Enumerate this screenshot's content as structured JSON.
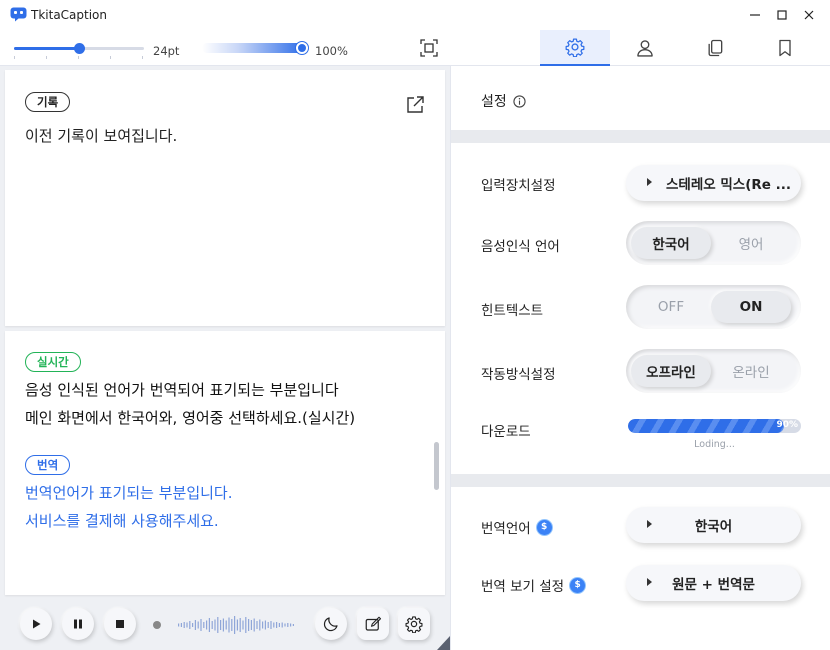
{
  "app": {
    "title": "TkitaCaption"
  },
  "window": {
    "minimize": "—",
    "maximize": "☐",
    "close": "✕"
  },
  "toolbar": {
    "font_size": "24pt",
    "opacity": "100%",
    "font_size_level": 0.5,
    "opacity_level": 1.0
  },
  "tabs": [
    {
      "icon": "gear-icon",
      "active": true
    },
    {
      "icon": "user-icon",
      "active": false
    },
    {
      "icon": "copy-icon",
      "active": false
    },
    {
      "icon": "bookmark-icon",
      "active": false
    }
  ],
  "history": {
    "badge": "기록",
    "text": "이전 기록이 보여집니다."
  },
  "live": {
    "badge": "실시간",
    "lines": [
      "음성 인식된 언어가 번역되어 표기되는 부분입니다",
      "메인 화면에서 한국어와, 영어중 선택하세요.(실시간)"
    ]
  },
  "translation": {
    "badge": "번역",
    "lines": [
      "번역언어가 표기되는 부분입니다.",
      "서비스를 결제해 사용해주세요."
    ]
  },
  "settings": {
    "title": "설정",
    "input_device": {
      "label": "입력장치설정",
      "value": "스테레오 믹스(Re ..."
    },
    "speech_lang": {
      "label": "음성인식 언어",
      "options": [
        "한국어",
        "영어"
      ],
      "selected": "한국어"
    },
    "hint_text": {
      "label": "힌트텍스트",
      "options": [
        "OFF",
        "ON"
      ],
      "selected": "ON"
    },
    "mode": {
      "label": "작동방식설정",
      "options": [
        "오프라인",
        "온라인"
      ],
      "selected": "오프라인"
    },
    "download": {
      "label": "다운로드",
      "progress": 0.9,
      "percent_text": "90%",
      "status": "Loding..."
    },
    "translate_lang": {
      "label": "번역언어",
      "value": "한국어"
    },
    "translate_view": {
      "label": "번역 보기 설정",
      "value": "원문 + 번역문"
    }
  },
  "colors": {
    "accent": "#2f6ee8",
    "live_badge": "#22b357",
    "panel_bg": "#eef0f4"
  }
}
